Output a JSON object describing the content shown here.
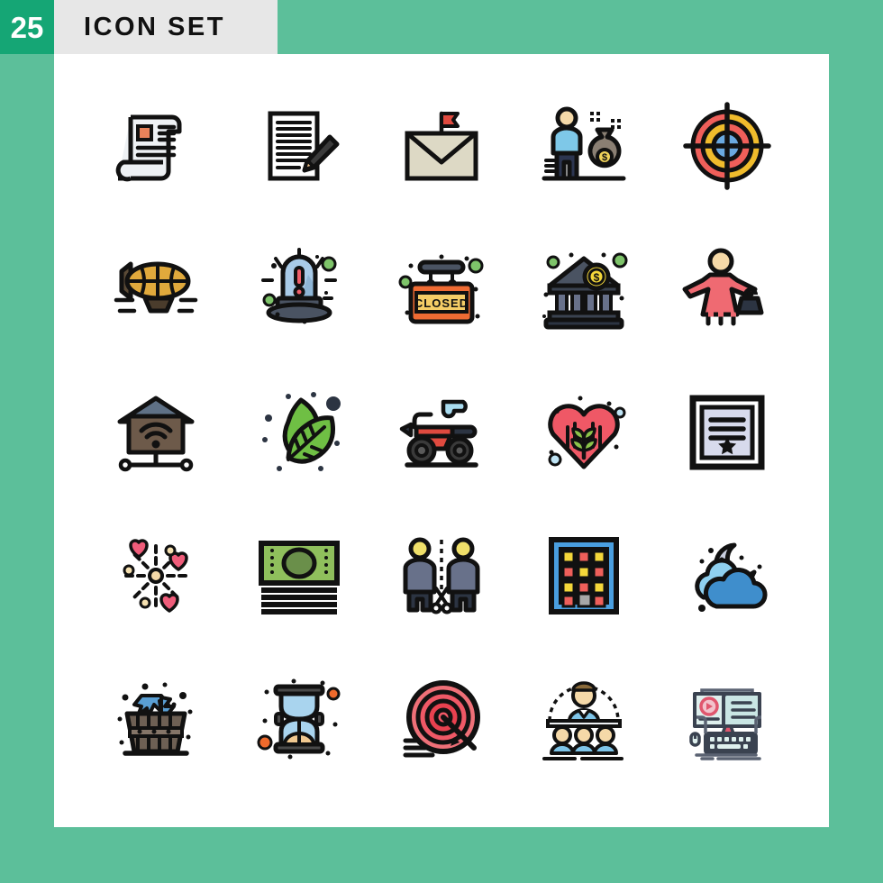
{
  "header": {
    "count": "25",
    "title": "Icon Set",
    "badge_color": "#15a675",
    "strip_color": "#e7e7e7",
    "title_color": "#111111"
  },
  "page": {
    "background_color": "#5cbf9a",
    "canvas_color": "#ffffff",
    "grid_columns": 5,
    "grid_rows": 5,
    "total_icons": 25
  },
  "icons": [
    {
      "index": 1,
      "row": 1,
      "col": 1,
      "name": "document-scroll-icon",
      "label": "Document Scroll",
      "accent": "#e8825a"
    },
    {
      "index": 2,
      "row": 1,
      "col": 2,
      "name": "write-document-icon",
      "label": "Write Document",
      "accent": "#3b3b3b"
    },
    {
      "index": 3,
      "row": 1,
      "col": 3,
      "name": "flagged-mail-icon",
      "label": "Flagged Mail",
      "accent": "#e04a3f"
    },
    {
      "index": 4,
      "row": 1,
      "col": 4,
      "name": "rich-businessman-icon",
      "label": "Rich Businessman",
      "accent": "#7ec8e8"
    },
    {
      "index": 5,
      "row": 1,
      "col": 5,
      "name": "crosshair-target-icon",
      "label": "Crosshair Target",
      "accent": "#f0bc2c"
    },
    {
      "index": 6,
      "row": 2,
      "col": 1,
      "name": "airship-blimp-icon",
      "label": "Airship Blimp",
      "accent": "#c8941f"
    },
    {
      "index": 7,
      "row": 2,
      "col": 2,
      "name": "emergency-siren-icon",
      "label": "Emergency Siren",
      "accent": "#a9cbe8"
    },
    {
      "index": 8,
      "row": 2,
      "col": 3,
      "name": "closed-sign-icon",
      "label": "Closed Sign",
      "accent": "#ef6b33"
    },
    {
      "index": 9,
      "row": 2,
      "col": 4,
      "name": "bank-building-icon",
      "label": "Bank Building",
      "accent": "#f4d73a"
    },
    {
      "index": 10,
      "row": 2,
      "col": 5,
      "name": "woman-with-handbag-icon",
      "label": "Woman With Handbag",
      "accent": "#ef6a72"
    },
    {
      "index": 11,
      "row": 3,
      "col": 1,
      "name": "smart-home-wifi-icon",
      "label": "Smart Home Wifi",
      "accent": "#6d5a4a"
    },
    {
      "index": 12,
      "row": 3,
      "col": 2,
      "name": "eco-leaves-icon",
      "label": "Eco Leaves",
      "accent": "#6fbf44"
    },
    {
      "index": 13,
      "row": 3,
      "col": 3,
      "name": "quad-bike-icon",
      "label": "Quad Bike",
      "accent": "#e04a3f"
    },
    {
      "index": 14,
      "row": 3,
      "col": 4,
      "name": "heart-plant-icon",
      "label": "Heart With Plant",
      "accent": "#ef5866"
    },
    {
      "index": 15,
      "row": 3,
      "col": 5,
      "name": "framed-certificate-icon",
      "label": "Framed Certificate",
      "accent": "#d7daec"
    },
    {
      "index": 16,
      "row": 4,
      "col": 1,
      "name": "love-fireworks-icon",
      "label": "Love Fireworks",
      "accent": "#ef5c7a"
    },
    {
      "index": 17,
      "row": 4,
      "col": 2,
      "name": "cash-banknote-icon",
      "label": "Cash Banknote",
      "accent": "#8fbf5c"
    },
    {
      "index": 18,
      "row": 4,
      "col": 3,
      "name": "separation-scissors-icon",
      "label": "Separation",
      "accent": "#f0e06a"
    },
    {
      "index": 19,
      "row": 4,
      "col": 4,
      "name": "office-building-icon",
      "label": "Office Building",
      "accent": "#4a9fe0"
    },
    {
      "index": 20,
      "row": 4,
      "col": 5,
      "name": "night-cloud-moon-icon",
      "label": "Night Cloud Moon",
      "accent": "#3f8ecc"
    },
    {
      "index": 21,
      "row": 5,
      "col": 1,
      "name": "sauna-bucket-icon",
      "label": "Sauna Bucket",
      "accent": "#6e6054"
    },
    {
      "index": 22,
      "row": 5,
      "col": 2,
      "name": "hourglass-icon",
      "label": "Hourglass",
      "accent": "#a9d4ee"
    },
    {
      "index": 23,
      "row": 5,
      "col": 3,
      "name": "dartboard-arrow-icon",
      "label": "Dartboard With Arrow",
      "accent": "#ef5866"
    },
    {
      "index": 24,
      "row": 5,
      "col": 4,
      "name": "conference-team-icon",
      "label": "Conference Team",
      "accent": "#7ec4e8"
    },
    {
      "index": 25,
      "row": 5,
      "col": 5,
      "name": "typewriter-book-icon",
      "label": "Typewriter Book",
      "accent": "#c9e6e4"
    }
  ]
}
